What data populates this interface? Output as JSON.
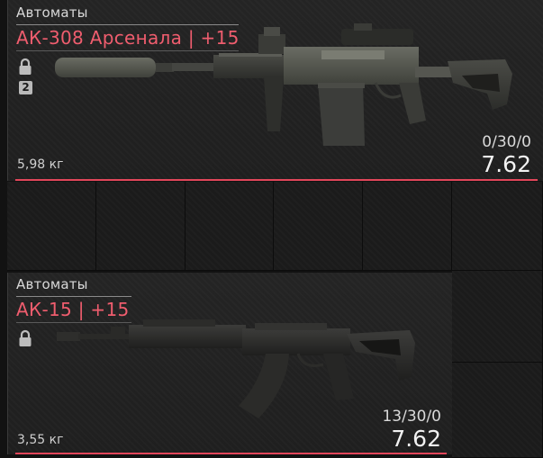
{
  "inventory": {
    "slot1": {
      "category": "Автоматы",
      "name": "АК-308 Арсенала | +15",
      "weight": "5,98 кг",
      "ammo": "0/30/0",
      "caliber": "7.62",
      "lock_icon": "lock-icon",
      "badge": "2"
    },
    "slot2": {
      "category": "Автоматы",
      "name": "АК-15 | +15",
      "weight": "3,55 кг",
      "ammo": "13/30/0",
      "caliber": "7.62",
      "lock_icon": "lock-icon"
    },
    "colors": {
      "accent": "#e2465a",
      "title": "#ef5d6e",
      "background": "#1b1b1b"
    }
  }
}
